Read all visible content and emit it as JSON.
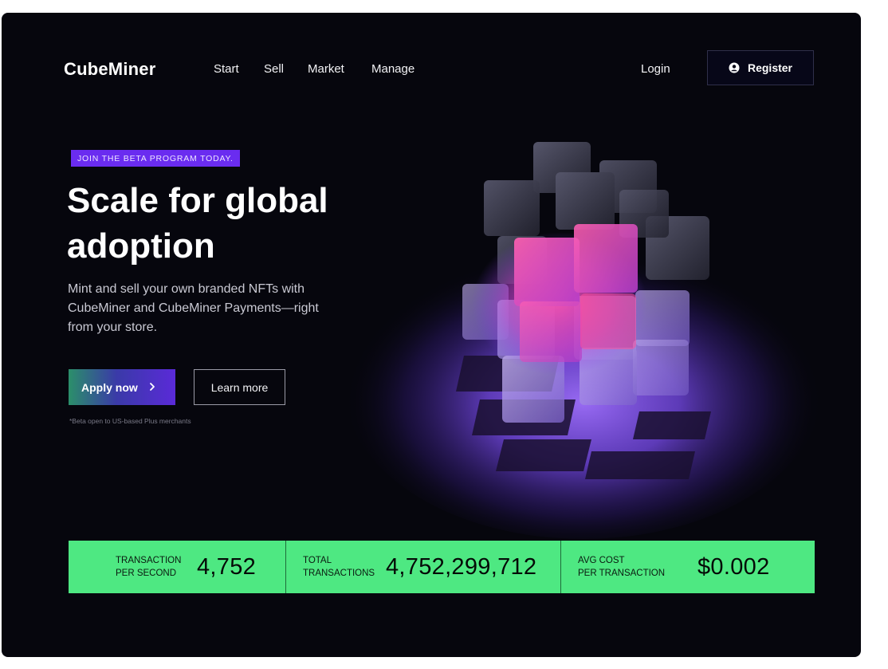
{
  "brand": {
    "name": "CubeMiner"
  },
  "nav": {
    "items": [
      {
        "label": "Start"
      },
      {
        "label": "Sell"
      },
      {
        "label": "Market"
      },
      {
        "label": "Manage"
      }
    ],
    "login_label": "Login",
    "register_label": "Register",
    "register_icon": "user-icon"
  },
  "hero": {
    "badge": "JOIN THE BETA PROGRAM TODAY.",
    "headline": "Scale for global adoption",
    "subtext": "Mint and sell your own branded NFTs with CubeMiner and CubeMiner Payments—right from your store.",
    "apply_label": "Apply now",
    "apply_icon": "chevron-right-icon",
    "learn_label": "Learn more",
    "footnote": "*Beta open to US-based Plus merchants"
  },
  "stats": [
    {
      "label": "TRANSACTION\nPER SECOND",
      "value": "4,752"
    },
    {
      "label": "TOTAL\nTRANSACTIONS",
      "value": "4,752,299,712"
    },
    {
      "label": "AVG COST\nPER TRANSACTION",
      "value": "$0.002"
    }
  ],
  "colors": {
    "background": "#06060d",
    "accent_purple": "#6a2cf0",
    "stats_green": "#4ee882"
  }
}
